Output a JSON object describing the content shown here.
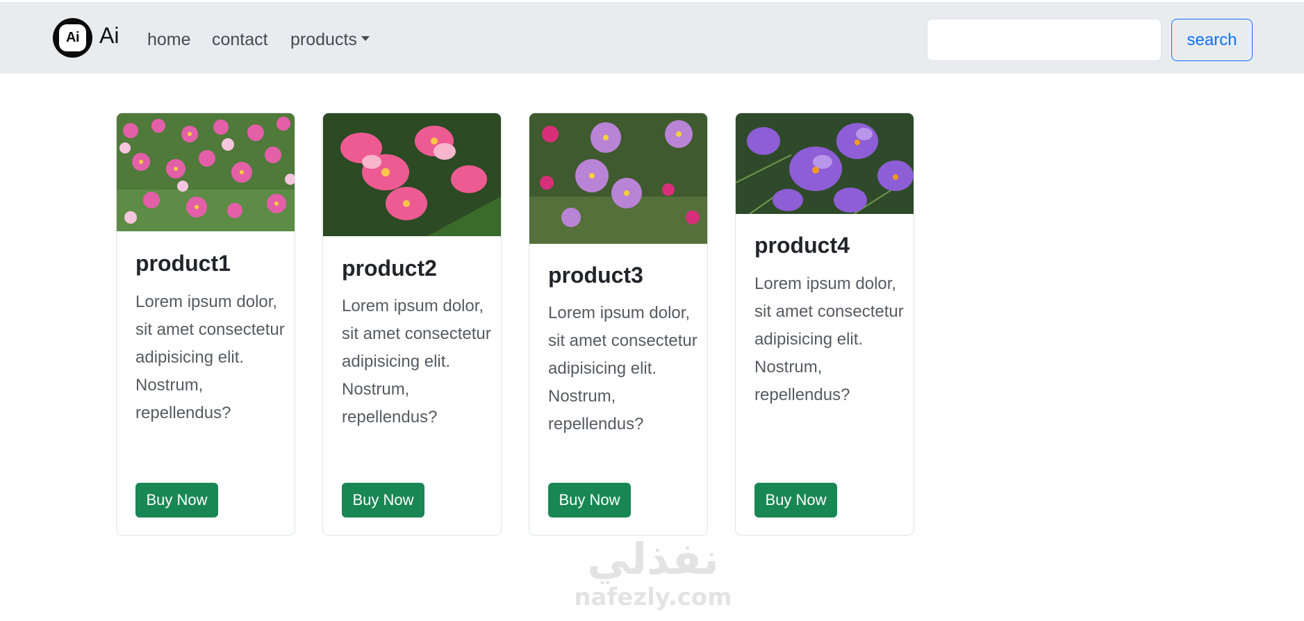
{
  "nav": {
    "logo_text": "Ai",
    "brand": "Ai",
    "links": [
      "home",
      "contact",
      "products"
    ],
    "search_placeholder": "",
    "search_button": "search"
  },
  "products": [
    {
      "title": "product1",
      "text": "Lorem ipsum dolor, sit amet consectetur adipisicing elit. Nostrum, repellendus?",
      "button": "Buy Now"
    },
    {
      "title": "product2",
      "text": "Lorem ipsum dolor, sit amet consectetur adipisicing elit. Nostrum, repellendus?",
      "button": "Buy Now"
    },
    {
      "title": "product3",
      "text": "Lorem ipsum dolor, sit amet consectetur adipisicing elit. Nostrum, repellendus?",
      "button": "Buy Now"
    },
    {
      "title": "product4",
      "text": "Lorem ipsum dolor, sit amet consectetur adipisicing elit. Nostrum, repellendus?",
      "button": "Buy Now"
    }
  ],
  "watermark": {
    "arabic": "نفذلي",
    "latin": "nafezly.com"
  },
  "colors": {
    "navbar_bg": "#e9ecef",
    "primary": "#0d6efd",
    "success": "#198754"
  }
}
